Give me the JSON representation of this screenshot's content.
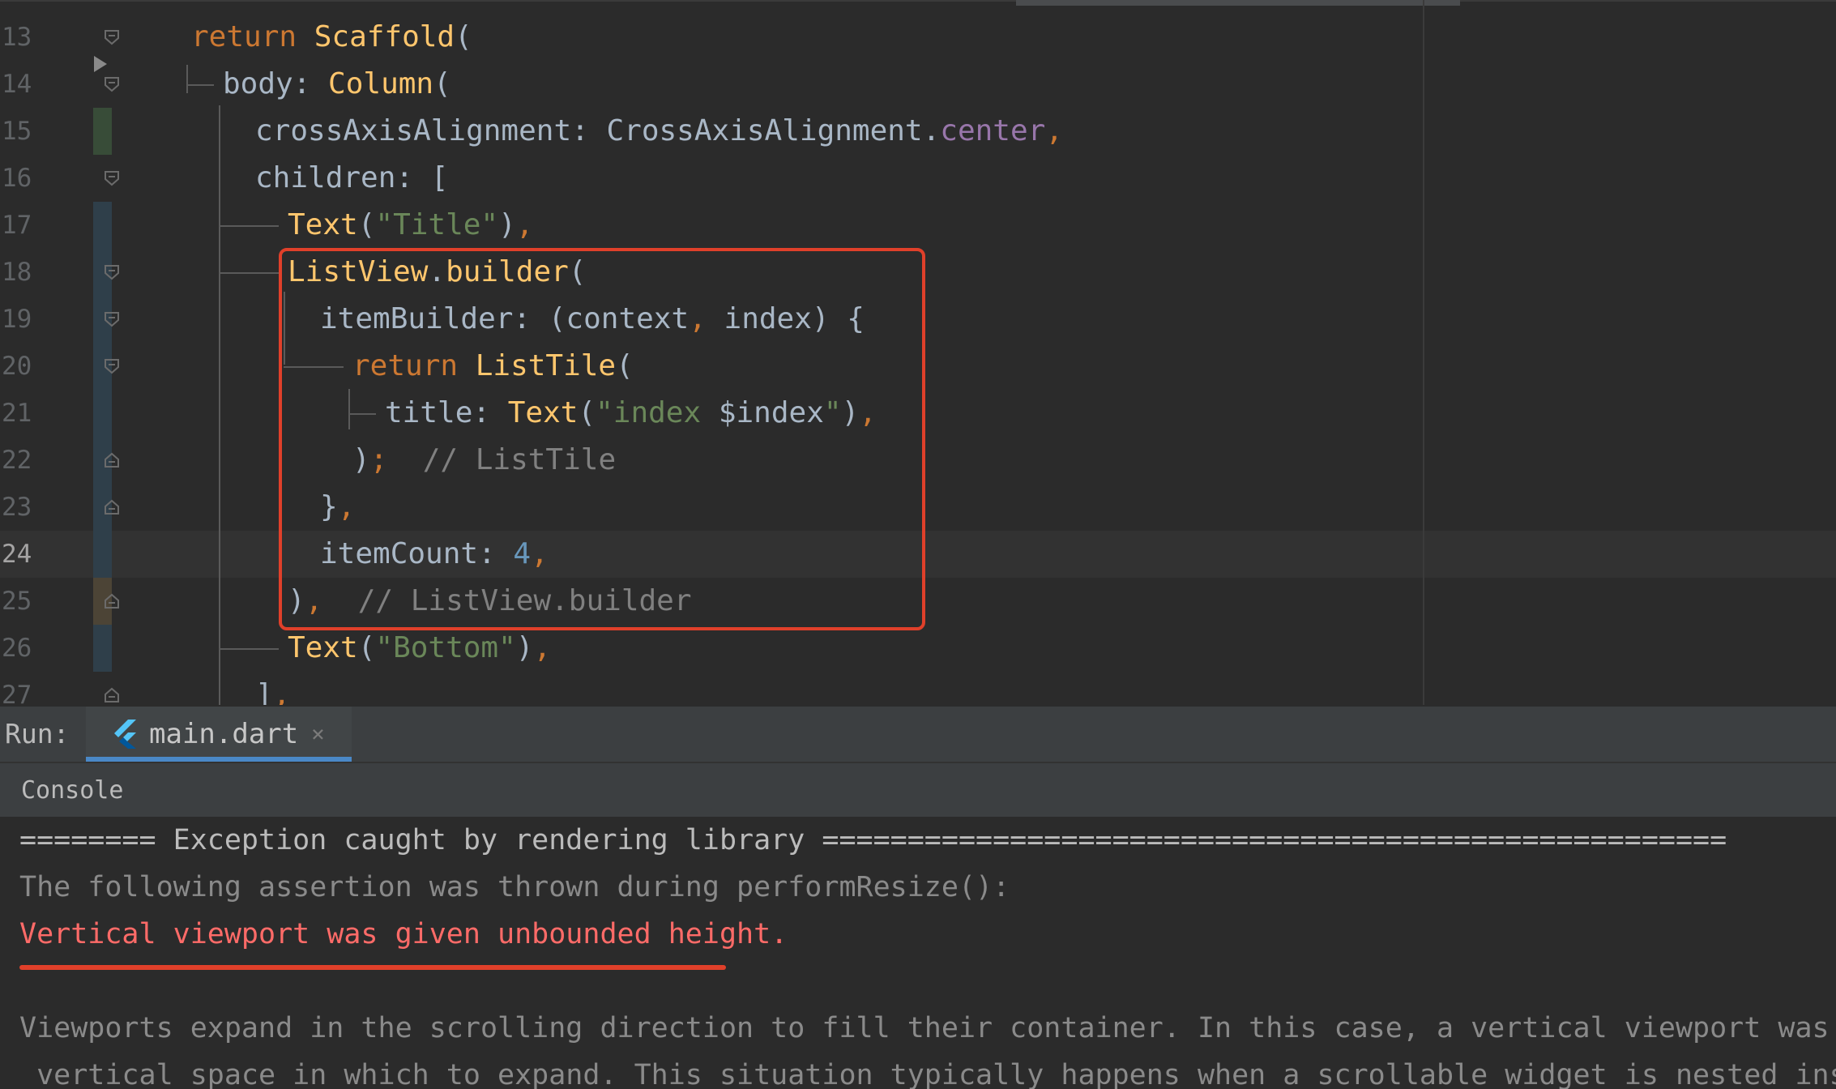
{
  "colors": {
    "background": "#2b2b2b",
    "keyword": "#cc7832",
    "identifier": "#a9b7c6",
    "class": "#ffc66d",
    "string": "#6a8759",
    "number": "#6897bb",
    "enum_constant": "#9876aa",
    "comment": "#808080",
    "line_number": "#606366",
    "highlight_box": "#e0402a",
    "error_text": "#ff6b68",
    "console_text": "#bbbbbb",
    "console_dim": "#8a8a8a",
    "tab_underline": "#4a88c7"
  },
  "editor": {
    "current_line": "24",
    "lines": [
      {
        "number": "13",
        "tokens": [
          {
            "text": "return ",
            "type": "keyword"
          },
          {
            "text": "Scaffold",
            "type": "class"
          },
          {
            "text": "(",
            "type": "identifier"
          }
        ]
      },
      {
        "number": "14",
        "tokens": [
          {
            "text": "body: ",
            "type": "identifier"
          },
          {
            "text": "Column",
            "type": "class"
          },
          {
            "text": "(",
            "type": "identifier"
          }
        ]
      },
      {
        "number": "15",
        "tokens": [
          {
            "text": "crossAxisAlignment: CrossAxisAlignment.",
            "type": "identifier"
          },
          {
            "text": "center",
            "type": "enum_constant"
          },
          {
            "text": ",",
            "type": "keyword"
          }
        ]
      },
      {
        "number": "16",
        "tokens": [
          {
            "text": "children: [",
            "type": "identifier"
          }
        ]
      },
      {
        "number": "17",
        "tokens": [
          {
            "text": "Text",
            "type": "class"
          },
          {
            "text": "(",
            "type": "identifier"
          },
          {
            "text": "\"Title\"",
            "type": "string"
          },
          {
            "text": ")",
            "type": "identifier"
          },
          {
            "text": ",",
            "type": "keyword"
          }
        ]
      },
      {
        "number": "18",
        "tokens": [
          {
            "text": "ListView",
            "type": "class"
          },
          {
            "text": ".",
            "type": "identifier"
          },
          {
            "text": "builder",
            "type": "class"
          },
          {
            "text": "(",
            "type": "identifier"
          }
        ]
      },
      {
        "number": "19",
        "tokens": [
          {
            "text": "itemBuilder: (context",
            "type": "identifier"
          },
          {
            "text": ", ",
            "type": "keyword"
          },
          {
            "text": "index) {",
            "type": "identifier"
          }
        ]
      },
      {
        "number": "20",
        "tokens": [
          {
            "text": "return ",
            "type": "keyword"
          },
          {
            "text": "ListTile",
            "type": "class"
          },
          {
            "text": "(",
            "type": "identifier"
          }
        ]
      },
      {
        "number": "21",
        "tokens": [
          {
            "text": "title: ",
            "type": "identifier"
          },
          {
            "text": "Text",
            "type": "class"
          },
          {
            "text": "(",
            "type": "identifier"
          },
          {
            "text": "\"index ",
            "type": "string"
          },
          {
            "text": "$index",
            "type": "identifier"
          },
          {
            "text": "\"",
            "type": "string"
          },
          {
            "text": ")",
            "type": "identifier"
          },
          {
            "text": ",",
            "type": "keyword"
          }
        ]
      },
      {
        "number": "22",
        "tokens": [
          {
            "text": ")",
            "type": "identifier"
          },
          {
            "text": ";  ",
            "type": "keyword"
          },
          {
            "text": "// ListTile",
            "type": "comment"
          }
        ]
      },
      {
        "number": "23",
        "tokens": [
          {
            "text": "}",
            "type": "identifier"
          },
          {
            "text": ",",
            "type": "keyword"
          }
        ]
      },
      {
        "number": "24",
        "tokens": [
          {
            "text": "itemCount: ",
            "type": "identifier"
          },
          {
            "text": "4",
            "type": "number"
          },
          {
            "text": ",",
            "type": "keyword"
          }
        ]
      },
      {
        "number": "25",
        "tokens": [
          {
            "text": ")",
            "type": "identifier"
          },
          {
            "text": ",  ",
            "type": "keyword"
          },
          {
            "text": "// ListView.builder",
            "type": "comment"
          }
        ]
      },
      {
        "number": "26",
        "tokens": [
          {
            "text": "Text",
            "type": "class"
          },
          {
            "text": "(",
            "type": "identifier"
          },
          {
            "text": "\"Bottom\"",
            "type": "string"
          },
          {
            "text": ")",
            "type": "identifier"
          },
          {
            "text": ",",
            "type": "keyword"
          }
        ]
      },
      {
        "number": "27",
        "tokens": [
          {
            "text": "]",
            "type": "identifier"
          },
          {
            "text": ",",
            "type": "keyword"
          }
        ]
      }
    ]
  },
  "run_panel": {
    "label": "Run:",
    "tab": {
      "icon": "flutter-icon",
      "title": "main.dart",
      "close_glyph": "×"
    },
    "console_label": "Console"
  },
  "console": {
    "lines": [
      "======== Exception caught by rendering library =====================================================",
      "The following assertion was thrown during performResize():",
      "Vertical viewport was given unbounded height.",
      "",
      "Viewports expand in the scrolling direction to fill their container. In this case, a vertical viewport was given",
      " vertical space in which to expand. This situation typically happens when a scrollable widget is nested inside ar"
    ]
  }
}
